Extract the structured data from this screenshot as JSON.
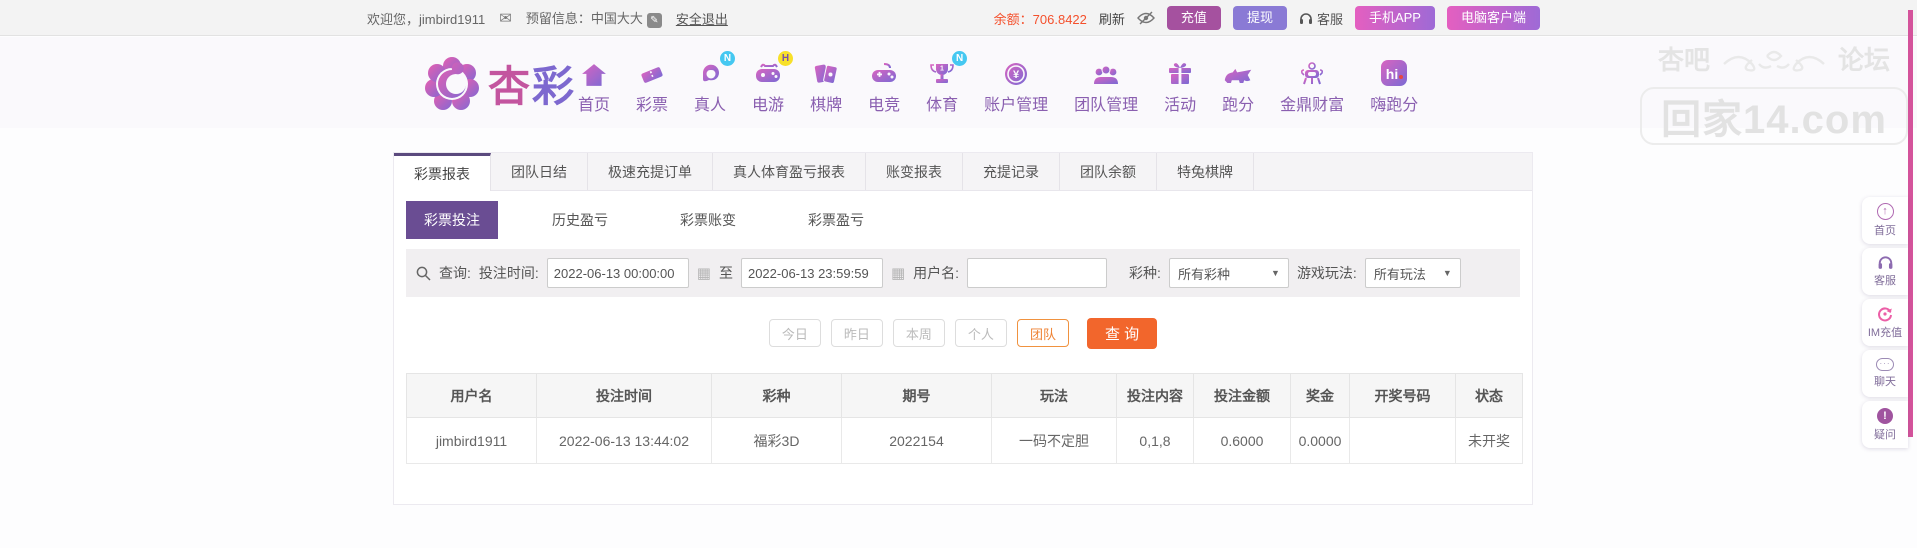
{
  "topbar": {
    "welcome": "欢迎您，jimbird1911",
    "reserved_info": "预留信息：中国大大",
    "logout": "安全退出",
    "balance_label": "余额：",
    "balance_value": "706.8422",
    "refresh_label": "刷新",
    "recharge_label": "充值",
    "withdraw_label": "提现",
    "service_label": "客服",
    "mobile_app_label": "手机APP",
    "pc_client_label": "电脑客户端"
  },
  "nav": {
    "logo_text_1": "杏",
    "logo_text_2": "彩",
    "items": [
      {
        "label": "首页",
        "badge": ""
      },
      {
        "label": "彩票",
        "badge": ""
      },
      {
        "label": "真人",
        "badge": "N"
      },
      {
        "label": "电游",
        "badge": "H"
      },
      {
        "label": "棋牌",
        "badge": ""
      },
      {
        "label": "电竞",
        "badge": ""
      },
      {
        "label": "体育",
        "badge": "N"
      },
      {
        "label": "账户管理",
        "badge": ""
      },
      {
        "label": "团队管理",
        "badge": ""
      },
      {
        "label": "活动",
        "badge": ""
      },
      {
        "label": "跑分",
        "badge": ""
      },
      {
        "label": "金鼎财富",
        "badge": ""
      },
      {
        "label": "嗨跑分",
        "badge": ""
      }
    ]
  },
  "tabs": [
    "彩票报表",
    "团队日结",
    "极速充提订单",
    "真人体育盈亏报表",
    "账变报表",
    "充提记录",
    "团队余额",
    "特兔棋牌"
  ],
  "subtabs": [
    "彩票投注",
    "历史盈亏",
    "彩票账变",
    "彩票盈亏"
  ],
  "query": {
    "search_label": "查询:",
    "bet_time_label": "投注时间:",
    "time_from": "2022-06-13 00:00:00",
    "to_label": "至",
    "time_to": "2022-06-13 23:59:59",
    "username_label": "用户名:",
    "username_value": "",
    "lottery_label": "彩种:",
    "lottery_selected": "所有彩种",
    "play_label": "游戏玩法:",
    "play_selected": "所有玩法"
  },
  "filters": {
    "today": "今日",
    "yesterday": "昨日",
    "this_week": "本周",
    "personal": "个人",
    "team": "团队",
    "search_button": "查 询"
  },
  "table": {
    "headers": [
      "用户名",
      "投注时间",
      "彩种",
      "期号",
      "玩法",
      "投注内容",
      "投注金额",
      "奖金",
      "开奖号码",
      "状态"
    ],
    "rows": [
      [
        "jimbird1911",
        "2022-06-13 13:44:02",
        "福彩3D",
        "2022154",
        "一码不定胆",
        "0,1,8",
        "0.6000",
        "0.0000",
        "",
        "未开奖"
      ]
    ]
  },
  "watermark": {
    "left": "杏吧",
    "right": "论坛",
    "line2": "回家14.com"
  },
  "sidebar": {
    "items": [
      {
        "label": "首页"
      },
      {
        "label": "客服"
      },
      {
        "label": "IM充值"
      },
      {
        "label": "聊天"
      },
      {
        "label": "疑问"
      }
    ]
  },
  "colors": {
    "brand_purple": "#8a5fb0",
    "active_subtab": "#6a4d93",
    "tab_accent": "#5b4a7e",
    "balance_orange": "#f4502c",
    "button_orange": "#f2662c",
    "status_green": "#2e9e46",
    "strip_pink": "#d4539b",
    "badge_cyan": "#45c8f1",
    "badge_yellow": "#f7e02a",
    "recharge_btn": "#a5519f",
    "withdraw_btn": "#8a7ad5"
  }
}
